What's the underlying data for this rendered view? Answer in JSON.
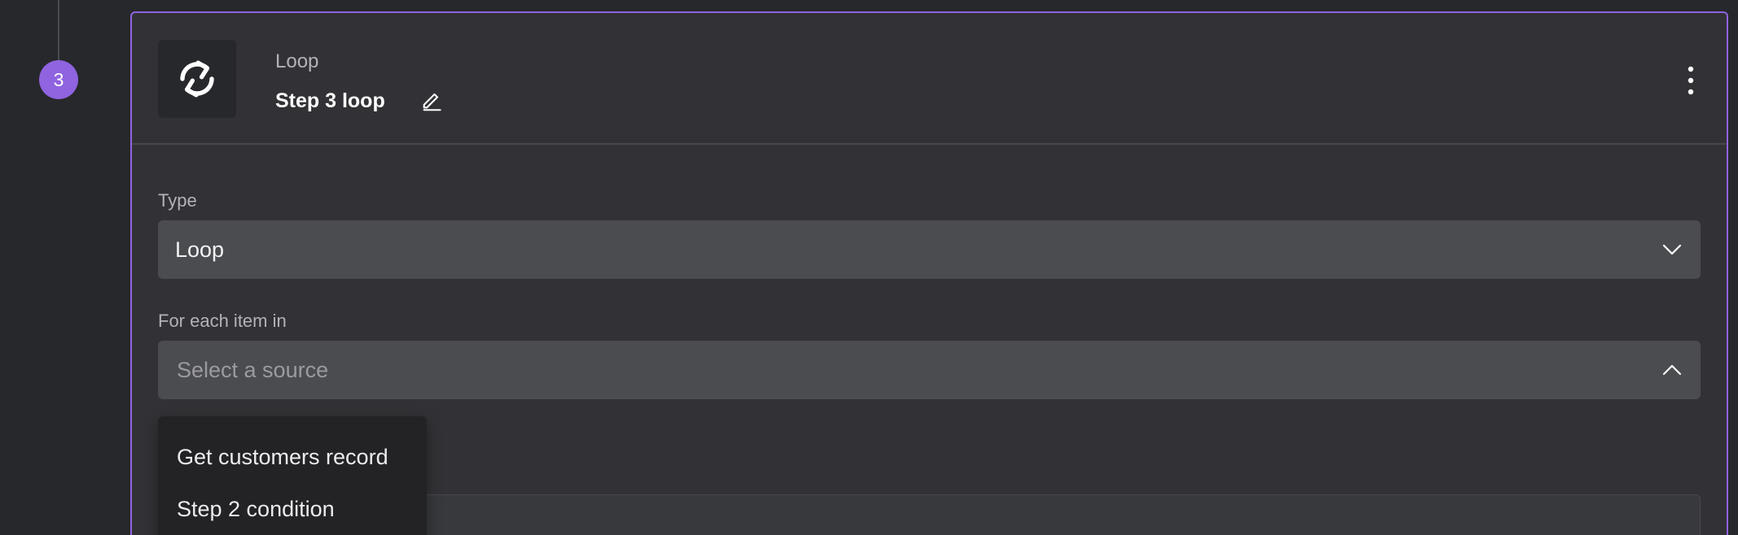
{
  "colors": {
    "accent": "#9063e0"
  },
  "timeline": {
    "step_number": "3"
  },
  "step": {
    "icon": "loop-icon",
    "kind_label": "Loop",
    "name": "Step 3 loop"
  },
  "type_field": {
    "label": "Type",
    "value": "Loop"
  },
  "source_field": {
    "label": "For each item in",
    "placeholder": "Select a source",
    "options": [
      "Get customers record",
      "Step 2 condition"
    ]
  }
}
